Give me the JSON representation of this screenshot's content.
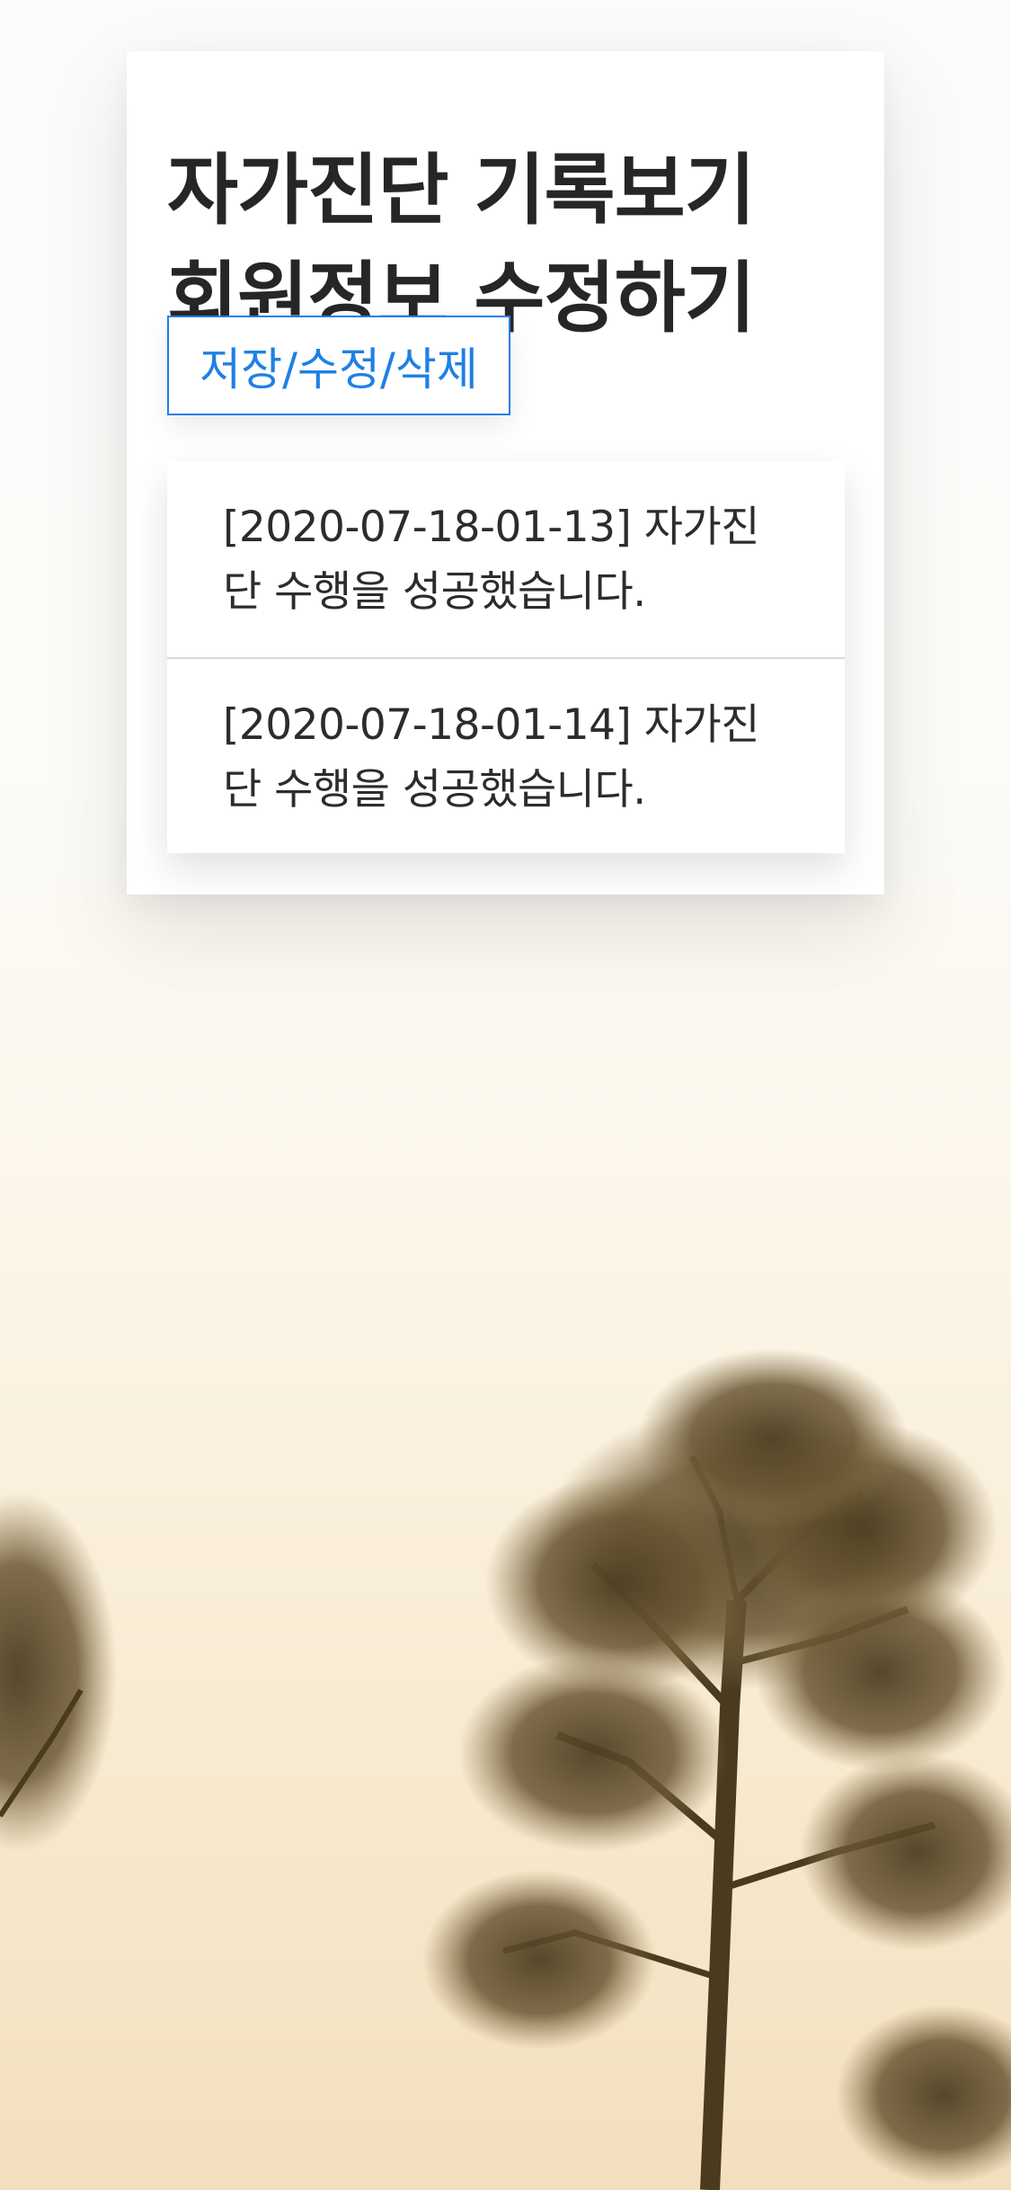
{
  "page": {
    "title_line1": "자가진단 기록보기",
    "title_line2": "회원정보 수정하기",
    "action_button_label": "저장/수정/삭제"
  },
  "logs": [
    {
      "line1": "[2020-07-18-01-13] 자가진",
      "line2": "단 수행을 성공했습니다."
    },
    {
      "line1": "[2020-07-18-01-14] 자가진",
      "line2": "단 수행을 성공했습니다."
    }
  ],
  "colors": {
    "accent": "#1f80e5",
    "title_text": "#262626",
    "body_text": "#2c2c2c",
    "divider": "#d8d8d8",
    "tree": "#5b4a2a"
  },
  "background": {
    "description_icon": "tree-silhouette"
  }
}
